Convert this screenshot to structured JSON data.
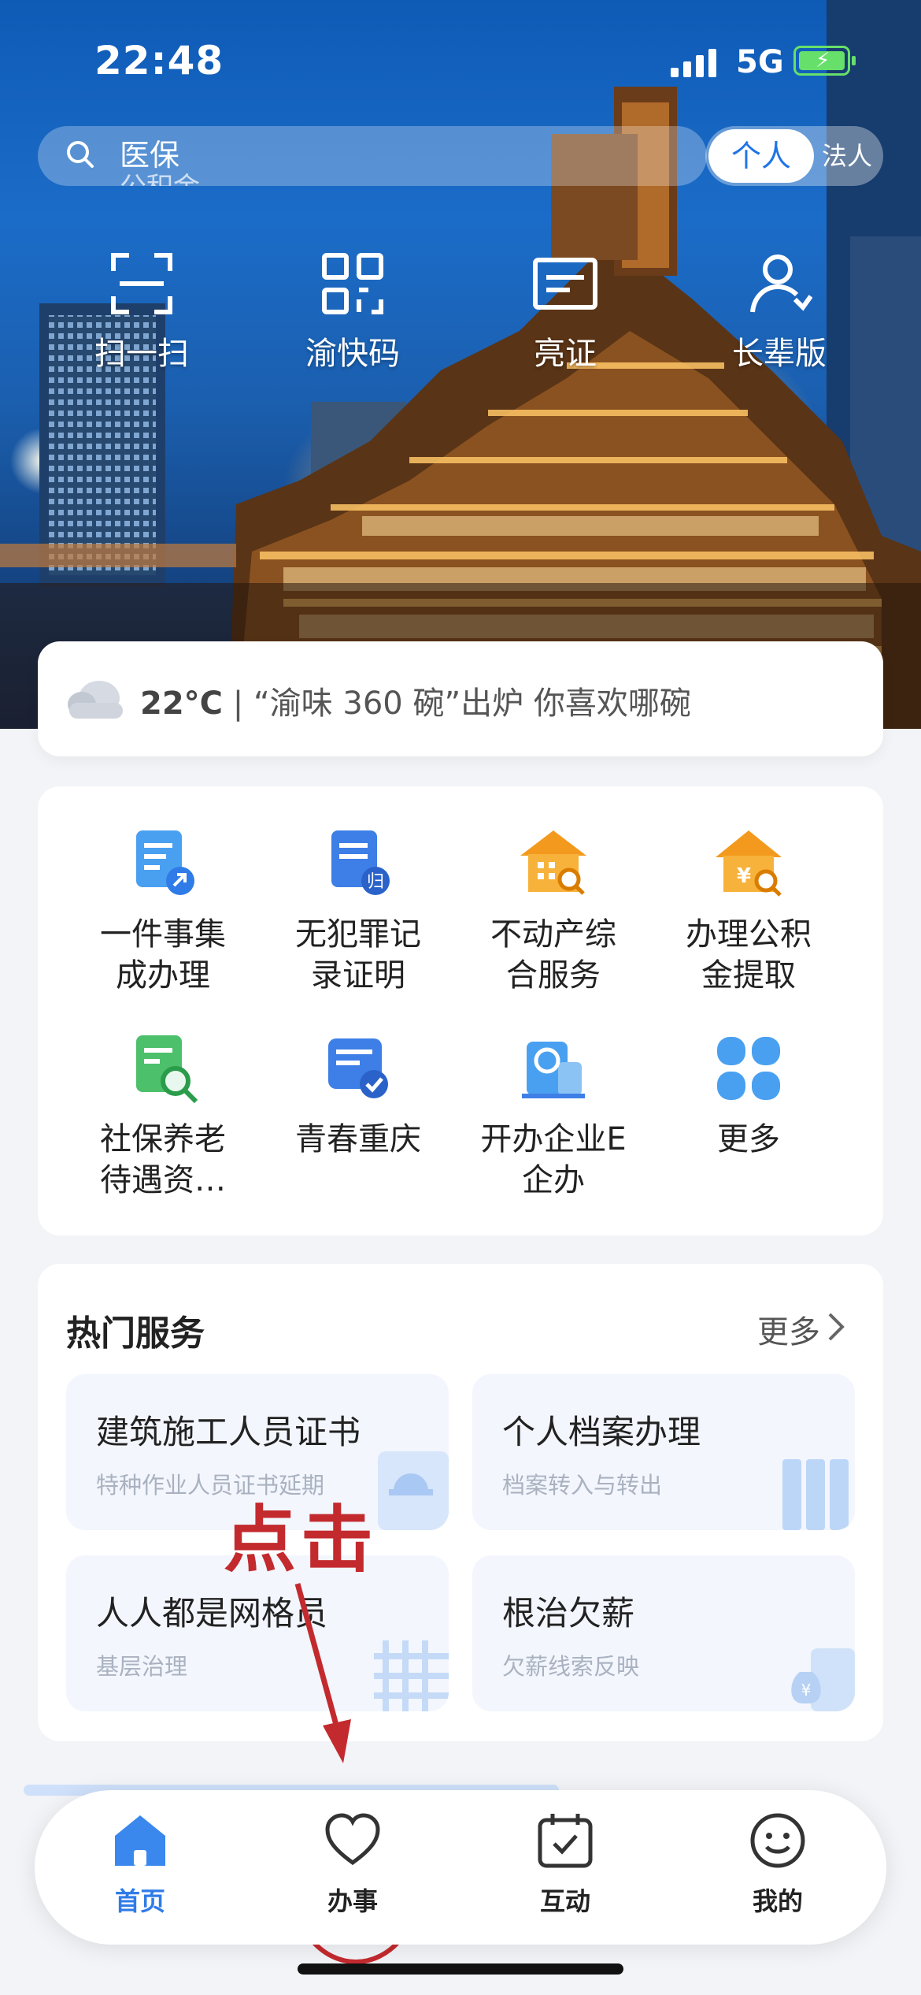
{
  "status_bar": {
    "time": "22:48",
    "network": "5G"
  },
  "search": {
    "line1": "医保",
    "line2": "公积金"
  },
  "identity_toggle": {
    "active": "个人",
    "inactive": "法人"
  },
  "quick_actions": [
    {
      "label": "扫一扫",
      "icon": "scan-icon"
    },
    {
      "label": "渝快码",
      "icon": "qr-code-icon"
    },
    {
      "label": "亮证",
      "icon": "id-card-icon"
    },
    {
      "label": "长辈版",
      "icon": "elder-mode-icon"
    }
  ],
  "weather": {
    "temperature": "22°C",
    "separator": "|",
    "headline": "“渝味 360 碗”出炉 你喜欢哪碗"
  },
  "services": [
    {
      "line1": "一件事集",
      "line2": "成办理",
      "icon": "checklist-rocket-icon"
    },
    {
      "line1": "无犯罪记",
      "line2": "录证明",
      "icon": "document-stamp-icon"
    },
    {
      "line1": "不动产综",
      "line2": "合服务",
      "icon": "house-search-icon"
    },
    {
      "line1": "办理公积",
      "line2": "金提取",
      "icon": "house-fund-icon"
    },
    {
      "line1": "社保养老",
      "line2": "待遇资…",
      "icon": "pension-search-icon"
    },
    {
      "line1": "青春重庆",
      "line2": "",
      "icon": "youth-badge-icon"
    },
    {
      "line1": "开办企业E",
      "line2": "企办",
      "icon": "enterprise-icon"
    },
    {
      "line1": "更多",
      "line2": "",
      "icon": "more-grid-icon"
    }
  ],
  "hot_services": {
    "title": "热门服务",
    "more": "更多",
    "cards": [
      {
        "title": "建筑施工人员证书",
        "subtitle": "特种作业人员证书延期",
        "icon": "worker-helmet-icon"
      },
      {
        "title": "个人档案办理",
        "subtitle": "档案转入与转出",
        "icon": "archive-icon"
      },
      {
        "title": "人人都是网格员",
        "subtitle": "基层治理",
        "icon": "grid-icon"
      },
      {
        "title": "根治欠薪",
        "subtitle": "欠薪线索反映",
        "icon": "money-bag-icon"
      }
    ]
  },
  "annotation": {
    "text": "点击",
    "color": "#c32a2e"
  },
  "tab_bar": [
    {
      "label": "首页",
      "icon": "home-icon",
      "active": true
    },
    {
      "label": "办事",
      "icon": "heart-icon",
      "active": false
    },
    {
      "label": "互动",
      "icon": "calendar-check-icon",
      "active": false
    },
    {
      "label": "我的",
      "icon": "smiley-icon",
      "active": false
    }
  ],
  "colors": {
    "accent": "#2f7be8",
    "orange": "#f39a1e",
    "green": "#3cbf5c",
    "annotation_red": "#c32a2e"
  }
}
